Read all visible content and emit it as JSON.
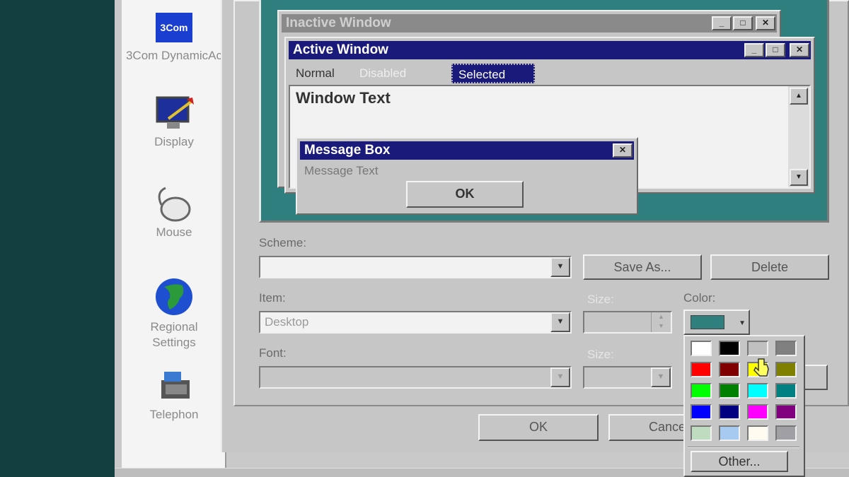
{
  "control_panel": {
    "items": [
      {
        "label": "3Com DynamicAc",
        "icon": "network-card-icon"
      },
      {
        "label": "Display",
        "icon": "display-icon"
      },
      {
        "label": "Mouse",
        "icon": "mouse-icon"
      },
      {
        "label": "Regional Settings",
        "icon": "globe-icon"
      },
      {
        "label": "Telephon",
        "icon": "telephony-icon"
      }
    ],
    "icon_badge": "3Com"
  },
  "preview": {
    "inactive_title": "Inactive Window",
    "active_title": "Active Window",
    "menu_normal": "Normal",
    "menu_disabled": "Disabled",
    "menu_selected": "Selected",
    "window_text": "Window Text",
    "msgbox_title": "Message Box",
    "msgbox_text": "Message Text",
    "msgbox_ok": "OK"
  },
  "form": {
    "scheme_label": "Scheme:",
    "scheme_value": "",
    "save_as": "Save As...",
    "delete": "Delete",
    "item_label": "Item:",
    "item_value": "Desktop",
    "size_label": "Size:",
    "color_label": "Color:",
    "font_label": "Font:",
    "font_size_label": "Size:",
    "ok": "OK",
    "cancel": "Cancel",
    "other": "Other..."
  },
  "colors": {
    "desktop": "#2f7f7f",
    "active_title": "#1a1a7a",
    "inactive_title": "#8a8a8a",
    "selected_color": "#2f7f7f",
    "palette": [
      "#ffffff",
      "#000000",
      "#c0c0c0",
      "#808080",
      "#ff0000",
      "#800000",
      "#ffff00",
      "#808000",
      "#00ff00",
      "#008000",
      "#00ffff",
      "#008080",
      "#0000ff",
      "#000080",
      "#ff00ff",
      "#800080",
      "#c0dcc0",
      "#a6caf0",
      "#fffbf0",
      "#a0a0a4"
    ]
  }
}
